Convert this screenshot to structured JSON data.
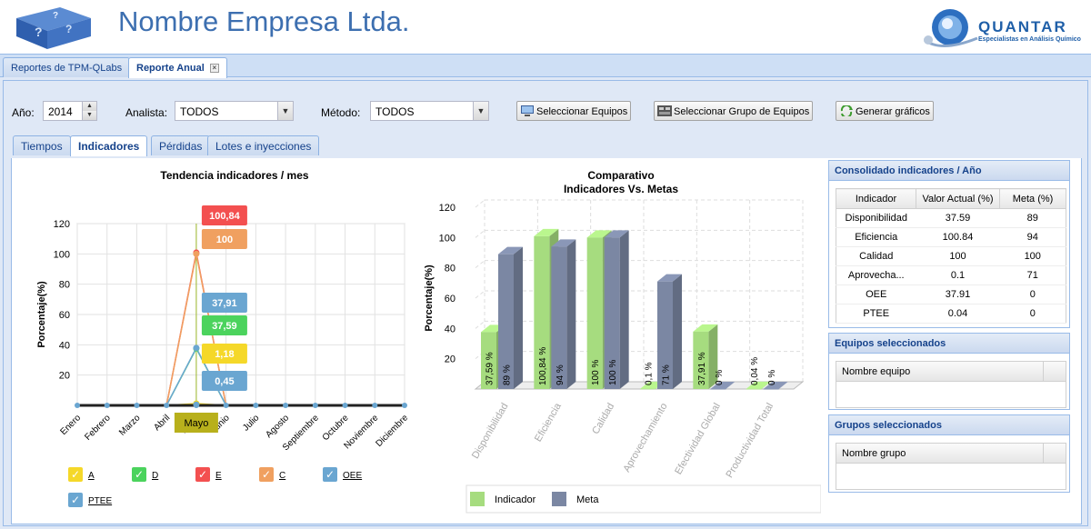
{
  "header": {
    "company_name": "Nombre Empresa Ltda.",
    "brand_name": "QUANTAR",
    "brand_tagline": "Especialistas en Análisis Químico"
  },
  "top_tabs": [
    {
      "label": "Reportes de TPM-QLabs",
      "active": false
    },
    {
      "label": "Reporte Anual",
      "active": true
    }
  ],
  "toolbar": {
    "year_label": "Año:",
    "year_value": "2014",
    "analyst_label": "Analista:",
    "analyst_value": "TODOS",
    "method_label": "Método:",
    "method_value": "TODOS",
    "btn_select_equipment": "Seleccionar Equipos",
    "btn_select_group": "Seleccionar Grupo de Equipos",
    "btn_generate": "Generar gráficos"
  },
  "sub_tabs": [
    {
      "label": "Tiempos",
      "active": false
    },
    {
      "label": "Indicadores",
      "active": true
    },
    {
      "label": "Pérdidas",
      "active": false
    },
    {
      "label": "Lotes e inyecciones",
      "active": false
    }
  ],
  "chart_data": [
    {
      "type": "line",
      "title": "Tendencia indicadores / mes",
      "ylabel": "Porcentaje(%)",
      "xlabel": "",
      "ylim": [
        0,
        120
      ],
      "yticks": [
        20,
        40,
        60,
        80,
        100,
        120
      ],
      "categories": [
        "Enero",
        "Febrero",
        "Marzo",
        "Abril",
        "Mayo",
        "Junio",
        "Julio",
        "Agosto",
        "Septiembre",
        "Octubre",
        "Noviembre",
        "Diciembre"
      ],
      "highlight_label": "Mayo",
      "series": [
        {
          "name": "A",
          "color": "#f5d829",
          "values": [
            0,
            0,
            0,
            0,
            1.18,
            0,
            0,
            0,
            0,
            0,
            0,
            0
          ],
          "label": "1,18"
        },
        {
          "name": "D",
          "color": "#4bd35d",
          "values": [
            0,
            0,
            0,
            0,
            37.59,
            0,
            0,
            0,
            0,
            0,
            0,
            0
          ],
          "label": "37,59"
        },
        {
          "name": "E",
          "color": "#f35050",
          "values": [
            0,
            0,
            0,
            0,
            100.84,
            0,
            0,
            0,
            0,
            0,
            0,
            0
          ],
          "label": "100,84"
        },
        {
          "name": "C",
          "color": "#f0a060",
          "values": [
            0,
            0,
            0,
            0,
            100,
            0,
            0,
            0,
            0,
            0,
            0,
            0
          ],
          "label": "100"
        },
        {
          "name": "OEE",
          "color": "#6aa6d1",
          "values": [
            0,
            0,
            0,
            0,
            37.91,
            0,
            0,
            0,
            0,
            0,
            0,
            0
          ],
          "label": "37,91"
        },
        {
          "name": "PTEE",
          "color": "#6aa6d1",
          "values": [
            0,
            0,
            0,
            0,
            0.45,
            0,
            0,
            0,
            0,
            0,
            0,
            0
          ],
          "label": "0,45"
        }
      ]
    },
    {
      "type": "bar",
      "title": "Comparativo",
      "subtitle": "Indicadores Vs. Metas",
      "ylabel": "Porcentaje(%)",
      "ylim": [
        0,
        120
      ],
      "yticks": [
        20,
        40,
        60,
        80,
        100,
        120
      ],
      "categories": [
        "Disponibilidad",
        "Eficiencia",
        "Calidad",
        "Aprovechamiento",
        "Efectividad Global",
        "Productividad Total"
      ],
      "series": [
        {
          "name": "Indicador",
          "color": "#a6dc7f",
          "values": [
            37.59,
            100.84,
            100,
            0.1,
            37.91,
            0.04
          ],
          "labels": [
            "37,59 %",
            "100,84 %",
            "100 %",
            "0,1 %",
            "37,91 %",
            "0,04 %"
          ]
        },
        {
          "name": "Meta",
          "color": "#7b87a3",
          "values": [
            89,
            94,
            100,
            71,
            0,
            0
          ],
          "labels": [
            "89 %",
            "94 %",
            "100 %",
            "71 %",
            "0 %",
            "0 %"
          ]
        }
      ]
    }
  ],
  "consolidated": {
    "title": "Consolidado indicadores / Año",
    "headers": [
      "Indicador",
      "Valor Actual (%)",
      "Meta (%)"
    ],
    "rows": [
      [
        "Disponibilidad",
        "37.59",
        "89"
      ],
      [
        "Eficiencia",
        "100.84",
        "94"
      ],
      [
        "Calidad",
        "100",
        "100"
      ],
      [
        "Aprovecha...",
        "0.1",
        "71"
      ],
      [
        "OEE",
        "37.91",
        "0"
      ],
      [
        "PTEE",
        "0.04",
        "0"
      ]
    ]
  },
  "equipment_panel": {
    "title": "Equipos seleccionados",
    "column": "Nombre equipo"
  },
  "groups_panel": {
    "title": "Grupos seleccionados",
    "column": "Nombre grupo"
  }
}
